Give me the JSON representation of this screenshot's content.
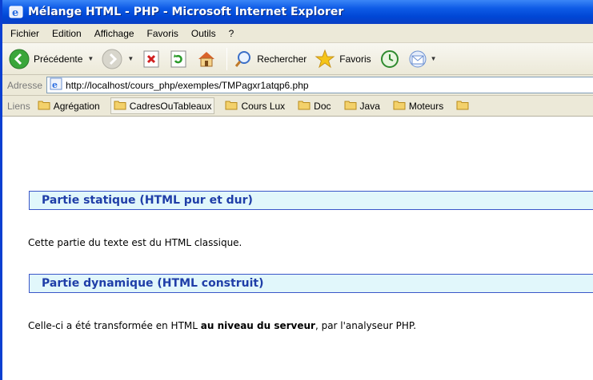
{
  "window": {
    "title": "Mélange HTML - PHP - Microsoft Internet Explorer"
  },
  "menu": [
    "Fichier",
    "Edition",
    "Affichage",
    "Favoris",
    "Outils",
    "?"
  ],
  "toolbar": {
    "back_label": "Précédente",
    "search_label": "Rechercher",
    "favorites_label": "Favoris"
  },
  "address": {
    "label": "Adresse",
    "url": "http://localhost/cours_php/exemples/TMPagxr1atqp6.php"
  },
  "links": {
    "label": "Liens",
    "items": [
      "Agrégation",
      "CadresOuTableaux",
      "Cours Lux",
      "Doc",
      "Java",
      "Moteurs"
    ]
  },
  "page": {
    "heading1": "Partie statique (HTML pur et dur)",
    "para1": "Cette partie du texte est du HTML classique.",
    "heading2": "Partie dynamique (HTML construit)",
    "para2_before": "Celle-ci a été transformée en HTML ",
    "para2_bold": "au niveau du serveur",
    "para2_after": ", par l'analyseur PHP."
  },
  "colors": {
    "titlebar": "#0046d5",
    "heading_bg": "#e1f7fb",
    "heading_text": "#1f3ea8",
    "heading_border": "#3a56c8"
  }
}
